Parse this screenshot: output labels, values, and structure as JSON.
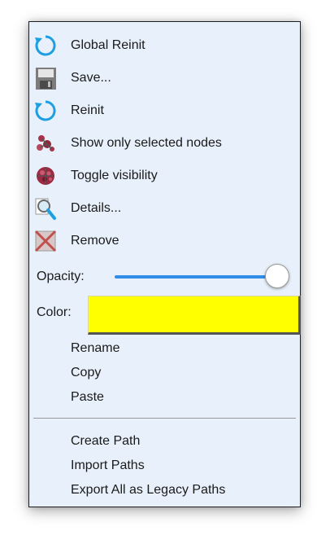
{
  "menu": {
    "top_items": [
      {
        "label": "Global Reinit",
        "icon": "refresh-icon"
      },
      {
        "label": "Save...",
        "icon": "save-disk-icon"
      },
      {
        "label": "Reinit",
        "icon": "refresh-icon"
      },
      {
        "label": "Show only selected nodes",
        "icon": "show-selected-nodes-icon"
      },
      {
        "label": "Toggle visibility",
        "icon": "toggle-visibility-icon"
      },
      {
        "label": "Details...",
        "icon": "magnifier-icon"
      },
      {
        "label": "Remove",
        "icon": "remove-cross-icon"
      }
    ],
    "opacity": {
      "label": "Opacity:",
      "value": 1.0
    },
    "color": {
      "label": "Color:",
      "value": "#ffff00"
    },
    "edit_items": [
      {
        "label": "Rename"
      },
      {
        "label": "Copy"
      },
      {
        "label": "Paste"
      }
    ],
    "path_items": [
      {
        "label": "Create Path"
      },
      {
        "label": "Import Paths"
      },
      {
        "label": "Export All as Legacy Paths"
      }
    ]
  },
  "colors": {
    "menu_background": "#e8f1fb",
    "slider_accent": "#2f8fe8",
    "refresh_icon": "#1e9fe0",
    "remove_icon": "#c0504d"
  }
}
